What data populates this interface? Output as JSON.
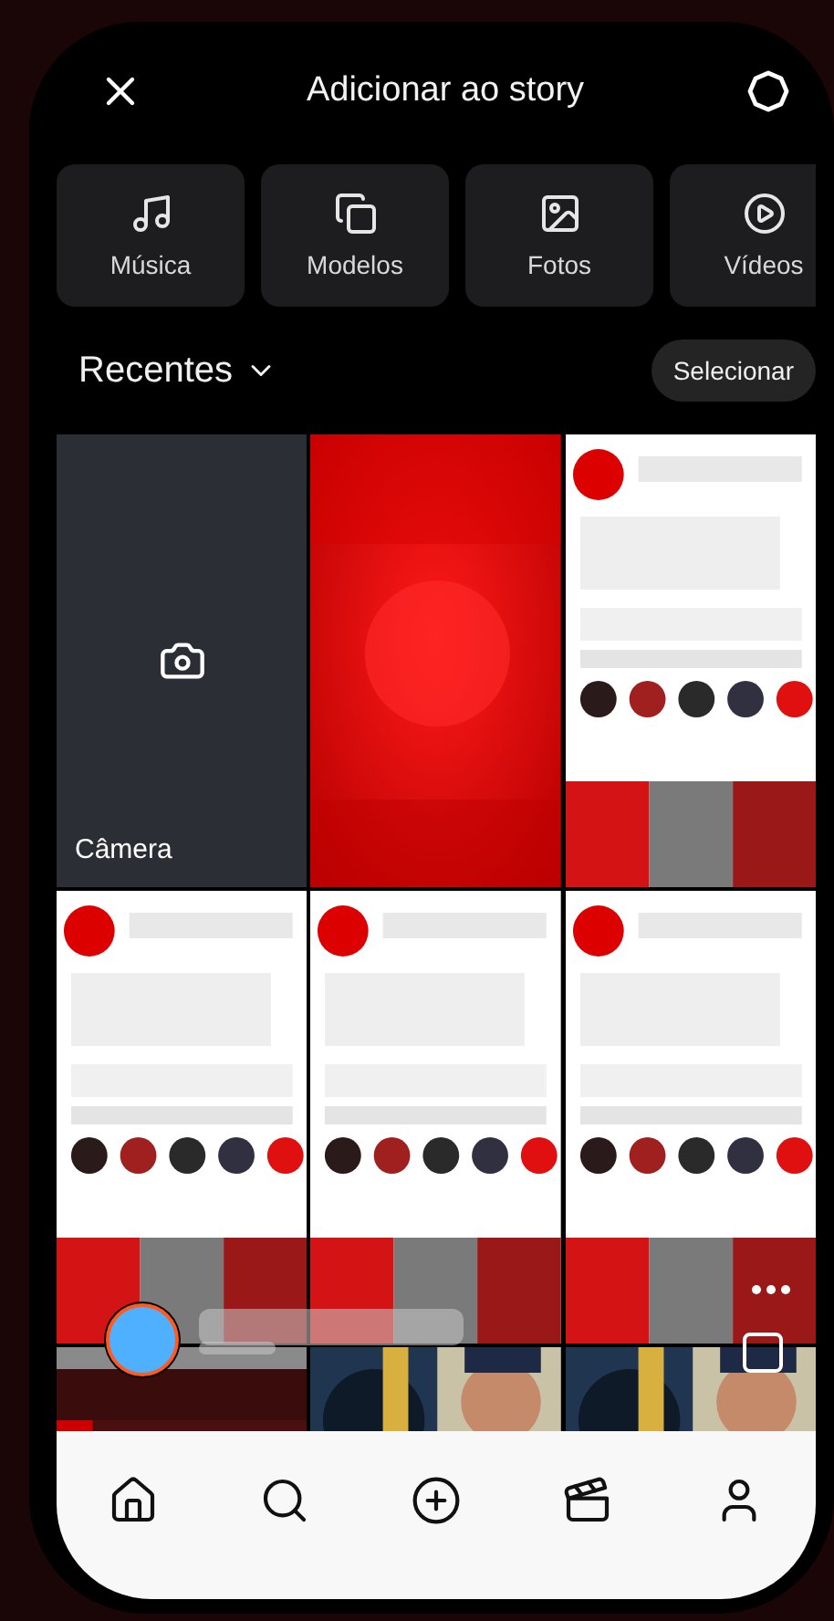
{
  "header": {
    "title": "Adicionar ao story"
  },
  "shortcuts": [
    {
      "kind": "music",
      "label": "Música"
    },
    {
      "kind": "templates",
      "label": "Modelos"
    },
    {
      "kind": "photos",
      "label": "Fotos"
    },
    {
      "kind": "videos",
      "label": "Vídeos"
    }
  ],
  "album": {
    "label": "Recentes",
    "select_button": "Selecionar"
  },
  "gallery": [
    {
      "kind": "camera",
      "label": "Câmera"
    },
    {
      "kind": "picture"
    },
    {
      "kind": "picture"
    },
    {
      "kind": "picture"
    },
    {
      "kind": "picture"
    },
    {
      "kind": "picture"
    },
    {
      "kind": "picture"
    },
    {
      "kind": "picture"
    },
    {
      "kind": "picture"
    }
  ],
  "tab_bar": [
    {
      "kind": "home"
    },
    {
      "kind": "search"
    },
    {
      "kind": "create"
    },
    {
      "kind": "reels"
    },
    {
      "kind": "profile"
    }
  ]
}
